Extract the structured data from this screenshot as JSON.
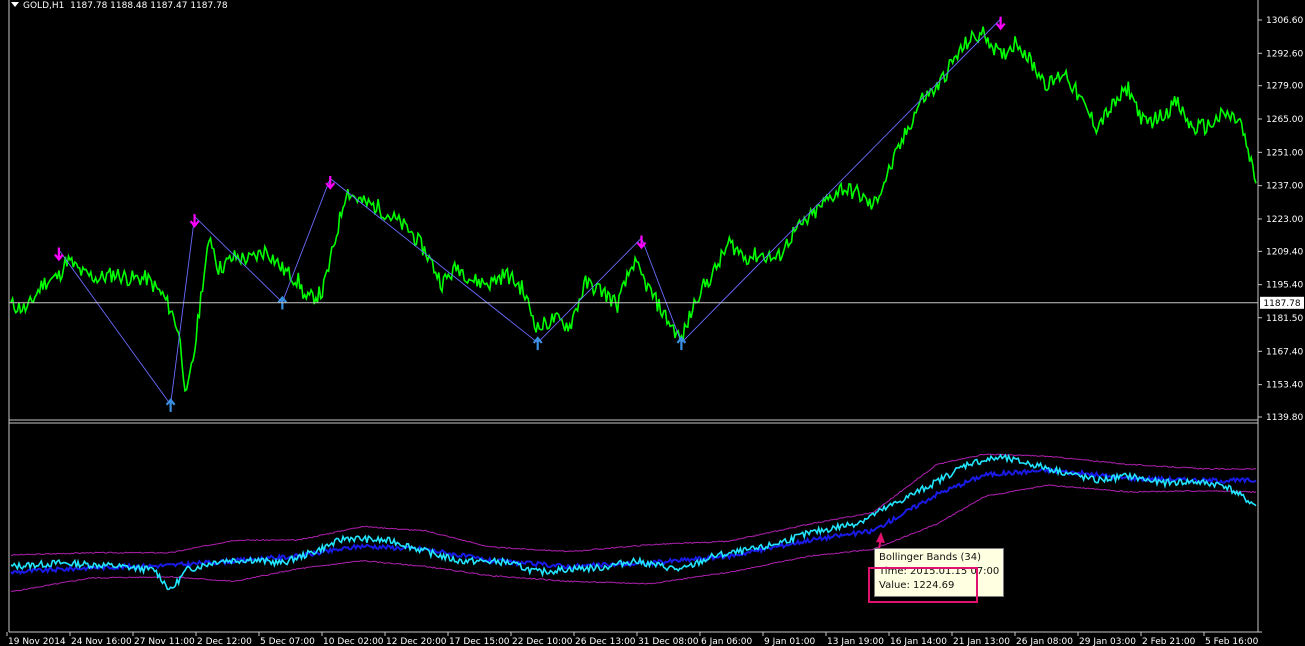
{
  "header": {
    "symbol": "GOLD,H1",
    "quote": "1187.78 1188.48 1187.47 1187.78"
  },
  "colors": {
    "price": "#00ff00",
    "down_arrow": "#ff00ff",
    "up_arrow": "#3a8fe0",
    "indicator": "#22e6ff",
    "band": "#1a1ae6",
    "band_outer": "#b020b0",
    "grid": "#c8c8c8"
  },
  "tooltip": {
    "title": "Bollinger Bands (34)",
    "time": "Time: 2015.01.15 07:00",
    "value": "Value: 1224.69"
  },
  "chart_data": {
    "type": "line",
    "current_price_label": "1187.78",
    "y_ticks": [
      "1306.60",
      "1292.60",
      "1279.00",
      "1265.00",
      "1251.00",
      "1237.00",
      "1223.00",
      "1209.40",
      "1195.40",
      "1181.50",
      "1167.40",
      "1153.40",
      "1139.80"
    ],
    "ylim": [
      1139.8,
      1306.6
    ],
    "x_ticks": [
      "19 Nov 2014",
      "24 Nov 16:00",
      "27 Nov 11:00",
      "2 Dec 12:00",
      "5 Dec 07:00",
      "10 Dec 02:00",
      "12 Dec 20:00",
      "17 Dec 15:00",
      "22 Dec 10:00",
      "26 Dec 13:00",
      "31 Dec 08:00",
      "6 Jan 06:00",
      "9 Jan 01:00",
      "13 Jan 19:00",
      "16 Jan 14:00",
      "21 Jan 13:00",
      "26 Jan 08:00",
      "29 Jan 03:00",
      "2 Feb 21:00",
      "5 Feb 16:00"
    ],
    "price_path": [
      [
        0,
        1187
      ],
      [
        2,
        1185
      ],
      [
        4,
        1196
      ],
      [
        6,
        1199
      ],
      [
        7,
        1206
      ],
      [
        9,
        1200
      ],
      [
        11,
        1198
      ],
      [
        13,
        1200
      ],
      [
        15,
        1198
      ],
      [
        17,
        1198
      ],
      [
        19,
        1191
      ],
      [
        20,
        1185
      ],
      [
        21,
        1176
      ],
      [
        22,
        1148
      ],
      [
        23,
        1168
      ],
      [
        24,
        1196
      ],
      [
        25,
        1216
      ],
      [
        26,
        1202
      ],
      [
        28,
        1207
      ],
      [
        30,
        1206
      ],
      [
        32,
        1210
      ],
      [
        34,
        1202
      ],
      [
        36,
        1197
      ],
      [
        37,
        1189
      ],
      [
        39,
        1192
      ],
      [
        40,
        1205
      ],
      [
        42,
        1235
      ],
      [
        44,
        1230
      ],
      [
        46,
        1228
      ],
      [
        48,
        1223
      ],
      [
        50,
        1218
      ],
      [
        52,
        1209
      ],
      [
        54,
        1196
      ],
      [
        56,
        1203
      ],
      [
        58,
        1197
      ],
      [
        60,
        1196
      ],
      [
        62,
        1200
      ],
      [
        64,
        1194
      ],
      [
        66,
        1177
      ],
      [
        68,
        1181
      ],
      [
        70,
        1178
      ],
      [
        72,
        1196
      ],
      [
        74,
        1193
      ],
      [
        76,
        1187
      ],
      [
        78,
        1205
      ],
      [
        80,
        1193
      ],
      [
        82,
        1182
      ],
      [
        84,
        1172
      ],
      [
        86,
        1191
      ],
      [
        88,
        1200
      ],
      [
        90,
        1213
      ],
      [
        92,
        1207
      ],
      [
        94,
        1208
      ],
      [
        96,
        1206
      ],
      [
        98,
        1217
      ],
      [
        100,
        1223
      ],
      [
        102,
        1230
      ],
      [
        104,
        1236
      ],
      [
        106,
        1234
      ],
      [
        108,
        1228
      ],
      [
        110,
        1243
      ],
      [
        112,
        1258
      ],
      [
        114,
        1273
      ],
      [
        116,
        1278
      ],
      [
        118,
        1289
      ],
      [
        120,
        1298
      ],
      [
        122,
        1301
      ],
      [
        124,
        1291
      ],
      [
        126,
        1298
      ],
      [
        128,
        1288
      ],
      [
        130,
        1279
      ],
      [
        132,
        1285
      ],
      [
        134,
        1273
      ],
      [
        136,
        1262
      ],
      [
        138,
        1270
      ],
      [
        140,
        1278
      ],
      [
        142,
        1263
      ],
      [
        144,
        1266
      ],
      [
        146,
        1272
      ],
      [
        148,
        1261
      ],
      [
        150,
        1262
      ],
      [
        152,
        1267
      ],
      [
        154,
        1264
      ],
      [
        156,
        1238
      ]
    ],
    "down_arrows": [
      [
        6,
        1206
      ],
      [
        23,
        1220
      ],
      [
        40,
        1236
      ],
      [
        79,
        1211
      ],
      [
        124,
        1303
      ]
    ],
    "up_arrows": [
      [
        20,
        1147
      ],
      [
        34,
        1190
      ],
      [
        66,
        1173
      ],
      [
        84,
        1173
      ]
    ],
    "indicator": {
      "name": "Bollinger Bands (34)",
      "main_path": [
        [
          0,
          1191
        ],
        [
          6,
          1194
        ],
        [
          12,
          1192
        ],
        [
          18,
          1188
        ],
        [
          20,
          1170
        ],
        [
          22,
          1188
        ],
        [
          26,
          1196
        ],
        [
          30,
          1197
        ],
        [
          34,
          1194
        ],
        [
          38,
          1204
        ],
        [
          42,
          1216
        ],
        [
          48,
          1213
        ],
        [
          52,
          1204
        ],
        [
          56,
          1196
        ],
        [
          62,
          1195
        ],
        [
          66,
          1186
        ],
        [
          70,
          1189
        ],
        [
          74,
          1190
        ],
        [
          78,
          1196
        ],
        [
          84,
          1188
        ],
        [
          88,
          1200
        ],
        [
          94,
          1207
        ],
        [
          100,
          1220
        ],
        [
          106,
          1229
        ],
        [
          110,
          1243
        ],
        [
          116,
          1265
        ],
        [
          120,
          1281
        ],
        [
          124,
          1286
        ],
        [
          128,
          1280
        ],
        [
          132,
          1273
        ],
        [
          136,
          1266
        ],
        [
          140,
          1270
        ],
        [
          144,
          1264
        ],
        [
          148,
          1265
        ],
        [
          152,
          1262
        ],
        [
          156,
          1244
        ]
      ],
      "upper_band": [
        [
          0,
          1201
        ],
        [
          10,
          1203
        ],
        [
          20,
          1203
        ],
        [
          28,
          1214
        ],
        [
          36,
          1214
        ],
        [
          44,
          1226
        ],
        [
          52,
          1222
        ],
        [
          60,
          1208
        ],
        [
          70,
          1204
        ],
        [
          80,
          1210
        ],
        [
          90,
          1213
        ],
        [
          100,
          1228
        ],
        [
          108,
          1238
        ],
        [
          116,
          1280
        ],
        [
          122,
          1289
        ],
        [
          130,
          1287
        ],
        [
          140,
          1280
        ],
        [
          150,
          1276
        ],
        [
          156,
          1276
        ]
      ],
      "lower_band": [
        [
          0,
          1169
        ],
        [
          10,
          1181
        ],
        [
          20,
          1182
        ],
        [
          28,
          1178
        ],
        [
          36,
          1189
        ],
        [
          44,
          1196
        ],
        [
          52,
          1191
        ],
        [
          60,
          1183
        ],
        [
          70,
          1178
        ],
        [
          80,
          1176
        ],
        [
          90,
          1186
        ],
        [
          100,
          1200
        ],
        [
          108,
          1206
        ],
        [
          116,
          1228
        ],
        [
          122,
          1252
        ],
        [
          130,
          1262
        ],
        [
          140,
          1256
        ],
        [
          150,
          1257
        ],
        [
          156,
          1256
        ]
      ],
      "mid_band": [
        [
          0,
          1186
        ],
        [
          10,
          1190
        ],
        [
          20,
          1192
        ],
        [
          28,
          1196
        ],
        [
          36,
          1200
        ],
        [
          44,
          1209
        ],
        [
          52,
          1206
        ],
        [
          60,
          1196
        ],
        [
          70,
          1191
        ],
        [
          80,
          1194
        ],
        [
          90,
          1200
        ],
        [
          100,
          1214
        ],
        [
          108,
          1222
        ],
        [
          116,
          1254
        ],
        [
          122,
          1271
        ],
        [
          130,
          1275
        ],
        [
          140,
          1268
        ],
        [
          150,
          1266
        ],
        [
          156,
          1266
        ]
      ]
    }
  }
}
